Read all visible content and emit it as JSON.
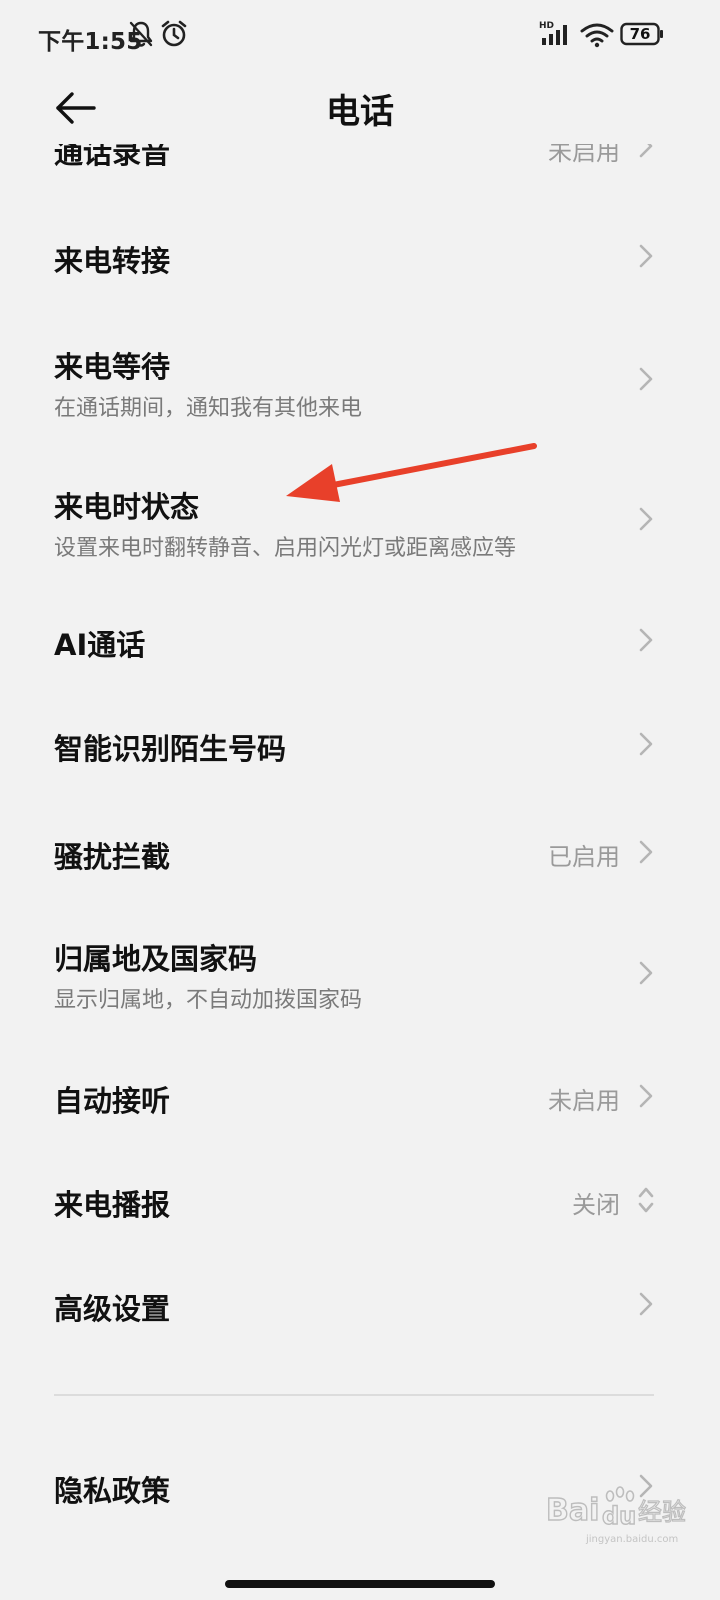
{
  "status_bar": {
    "time": "下午1:55",
    "icons": [
      "mute-icon",
      "alarm-icon",
      "hd-signal-icon",
      "wifi-icon",
      "battery-icon"
    ],
    "hd_label": "HD",
    "battery": "76"
  },
  "header": {
    "title": "电话",
    "back_icon": "back-arrow-icon"
  },
  "list": {
    "items": [
      {
        "title": "通话录音",
        "value": "未启用"
      },
      {
        "title": "来电转接"
      },
      {
        "title": "来电等待",
        "subtitle": "在通话期间，通知我有其他来电"
      },
      {
        "title": "来电时状态",
        "subtitle": "设置来电时翻转静音、启用闪光灯或距离感应等"
      },
      {
        "title": "AI通话"
      },
      {
        "title": "智能识别陌生号码"
      },
      {
        "title": "骚扰拦截",
        "value": "已启用"
      },
      {
        "title": "归属地及国家码",
        "subtitle": "显示归属地，不自动加拨国家码"
      },
      {
        "title": "自动接听",
        "value": "未启用"
      },
      {
        "title": "来电播报",
        "value": "关闭"
      },
      {
        "title": "高级设置"
      },
      {
        "title": "隐私政策"
      }
    ]
  },
  "annotation": {
    "icon": "red-arrow-icon",
    "color": "#e8402a"
  },
  "watermark": {
    "brand_a": "Bai",
    "brand_b": "du",
    "suffix": "经验",
    "site": "jingyan.baidu.com",
    "icon": "baidu-paw-icon"
  },
  "colors": {
    "background": "#f2f2f2",
    "text_primary": "#111111",
    "text_secondary": "#7a7a7a",
    "value_text": "#9a9a9a",
    "chevron": "#b5b5b5",
    "annotation": "#e8402a"
  }
}
